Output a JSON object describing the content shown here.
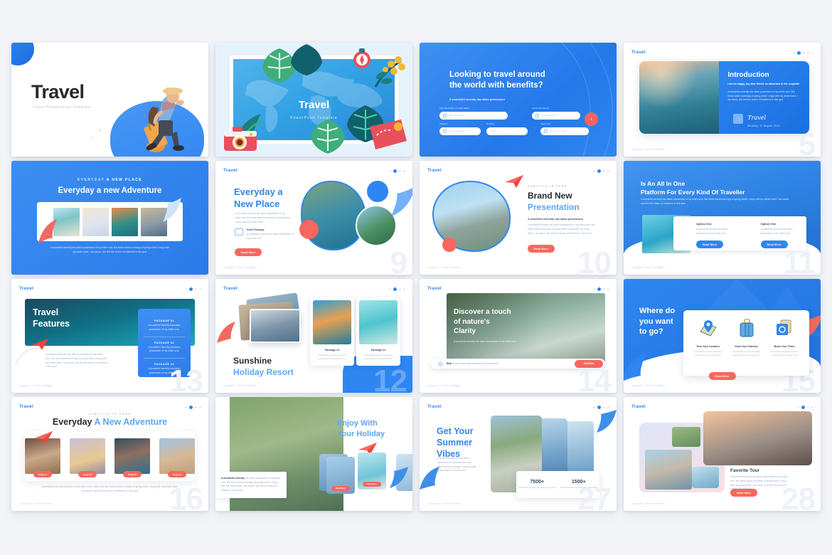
{
  "page": {
    "background": "#f2f4f8",
    "accent_blue": "#2f86f0",
    "accent_coral": "#f8675f"
  },
  "common": {
    "brand": "Travel",
    "footer": "Copyright © Travel, All Rights",
    "lorem_short": "A wonderful serenity has taken possession of my entire soul, like these sweet mornings of spring which I enjoy with my whole heart.",
    "lorem_long": "A wonderful serenity has taken possession of my entire soul, like these sweet mornings of spring which I enjoy with my whole heart. I am alone, and feel the charm of existence in this spot.",
    "lorem_tiny": "A wonderful serenity has taken possession of my entire soul."
  },
  "slides": [
    {
      "number": "",
      "name": "cover-hero",
      "title": "Travel",
      "subtitle": "Travel Presentation Template"
    },
    {
      "number": "",
      "name": "cover-tropical",
      "title": "Travel",
      "subtitle": "PowerPoint Template"
    },
    {
      "number": "",
      "name": "search-benefits",
      "title": "Looking to travel around\nthe world with benefits?",
      "caption": "A wonderful serenity has taken possession",
      "fields": [
        {
          "label": "City, Destination or Hotel Name",
          "value": "Your Destination"
        },
        {
          "label": "Guest and Rooms",
          "value": "1 Guest, 1 Room"
        },
        {
          "label": "Check In",
          "value": "Day of your date"
        },
        {
          "label": "Duration",
          "value": "1 night"
        },
        {
          "label": "Check Out",
          "value": "Next on your date"
        }
      ],
      "submit_icon": "chevron-right-icon"
    },
    {
      "number": "5",
      "name": "introduction",
      "title": "Introduction",
      "lead": "I am so happy, my dear friend, so absorbed in the exquisite",
      "signature": "Travel",
      "date": "Monday, 11 August 2021"
    },
    {
      "number": "",
      "name": "everyday-new-place-gallery",
      "kicker_light": "EVERYDAY",
      "kicker_bold": "A NEW PLACE",
      "title": "Everyday a new Adventure"
    },
    {
      "number": "9",
      "name": "everyday-a-new-place",
      "title_1": "Everyday a",
      "title_2": "New Place",
      "feature_title": "Hotel Package",
      "cta": "Read More"
    },
    {
      "number": "10",
      "name": "brand-new-presentation",
      "kicker": "SUBTITLE IN HERE",
      "title_1": "Brand New",
      "title_2": "Presentation",
      "bold_line": "A wonderful serenity has taken possession",
      "cta": "Read More"
    },
    {
      "number": "11",
      "name": "all-in-one-platform",
      "title_1": "Is An All In One",
      "title_2": "Platform For Every Kind Of Traveller",
      "cards": [
        {
          "title": "Option One",
          "cta": "Read More"
        },
        {
          "title": "Option One",
          "cta": "Read More"
        }
      ]
    },
    {
      "number": "13",
      "name": "travel-features",
      "title_1": "Travel",
      "title_2": "Features",
      "packages": [
        {
          "label": "PACKAGE 01"
        },
        {
          "label": "PACKAGE 02"
        },
        {
          "label": "PACKAGE 03"
        }
      ]
    },
    {
      "number": "12",
      "name": "sunshine-holiday-resort",
      "title_1": "Sunshine",
      "title_2": "Holiday Resort",
      "packages": [
        {
          "title": "Package #1"
        },
        {
          "title": "Package #2"
        }
      ]
    },
    {
      "number": "14",
      "name": "natures-clarity-search",
      "title": "Discover a touch\nof nature's\nClarity",
      "search_value_bold": "Bali",
      "search_value_rest": "is an island and province of Indonesia",
      "search_button": "SEARCH"
    },
    {
      "number": "15",
      "name": "where-do-you-want-to-go",
      "title": "Where do\nyou want\nto go?",
      "steps": [
        {
          "icon": "map-pin-icon",
          "title": "Pick Your Location"
        },
        {
          "icon": "suitcase-icon",
          "title": "Grab Your Itinerary"
        },
        {
          "icon": "ticket-icon",
          "title": "Book Your Ticket"
        }
      ],
      "cta": "Read More"
    },
    {
      "number": "16",
      "name": "everyday-new-adventure",
      "kicker": "SUBTITLE IN HERE",
      "title_1": "Everyday",
      "title_2": "A New Adventure",
      "images": [
        {
          "label": "Image 01"
        },
        {
          "label": "Image 02"
        },
        {
          "label": "Image 03"
        },
        {
          "label": "Image 04"
        }
      ]
    },
    {
      "number": "",
      "name": "enjoy-with-your-holiday",
      "title_1": "Enjoy With",
      "title_2": "Your",
      "title_3": "Holiday",
      "note_bold": "A wonderful serenity",
      "thumbs": [
        {
          "cta": "Read More"
        },
        {
          "cta": "Read More"
        }
      ]
    },
    {
      "number": "27",
      "name": "get-your-summer-vibes",
      "title_1": "Get Your",
      "title_2": "Summer",
      "title_3": "Vibes",
      "stats": [
        {
          "value": "7500+",
          "label": "A wonderful serenity has taken possession"
        },
        {
          "value": "1500+",
          "label": "A wonderful serenity has taken possession"
        }
      ]
    },
    {
      "number": "28",
      "name": "favorite-tour",
      "title": "Favorite Tour",
      "cta": "Read More"
    }
  ]
}
